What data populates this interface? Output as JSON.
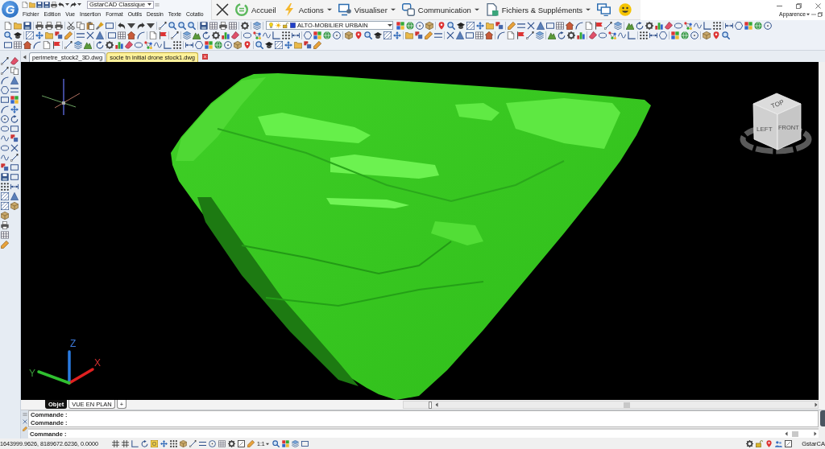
{
  "app": {
    "logo": "G",
    "workspace": "GstarCAD Classique"
  },
  "menu": [
    "Fichier",
    "Edition",
    "Vue",
    "Insertion",
    "Format",
    "Outils",
    "Dessin",
    "Texte",
    "Cotatio"
  ],
  "ribbon": {
    "items": [
      {
        "label": "Accueil",
        "dropdown": false
      },
      {
        "label": "Actions",
        "dropdown": true
      },
      {
        "label": "Visualiser",
        "dropdown": true
      },
      {
        "label": "Communication",
        "dropdown": true
      },
      {
        "label": "Fichiers & Suppléments",
        "dropdown": true
      }
    ]
  },
  "appearance": {
    "label": "Apparence"
  },
  "layer": {
    "name": "ALTO-MOBILIER URBAIN"
  },
  "drawing_tabs": [
    {
      "label": "perimetre_stock2_3D.dwg",
      "selected": false
    },
    {
      "label": "socle tn initial drone stock1.dwg",
      "selected": true
    }
  ],
  "viewport": {
    "viewcube": [
      "TOP",
      "LEFT",
      "FRONT"
    ],
    "axes": [
      "Z",
      "X",
      "Y"
    ]
  },
  "layout_tabs": [
    {
      "label": "Objet",
      "selected": true
    },
    {
      "label": "VUE EN PLAN",
      "selected": false
    }
  ],
  "new_layout": "+",
  "command": {
    "history": [
      "Commande :",
      "Commande :"
    ],
    "prompt": "Commande :"
  },
  "status_bar": {
    "coordinates": "1643999.9626, 8189672.6236, 0.0000",
    "scale": "1:1",
    "app": "GstarCA"
  }
}
